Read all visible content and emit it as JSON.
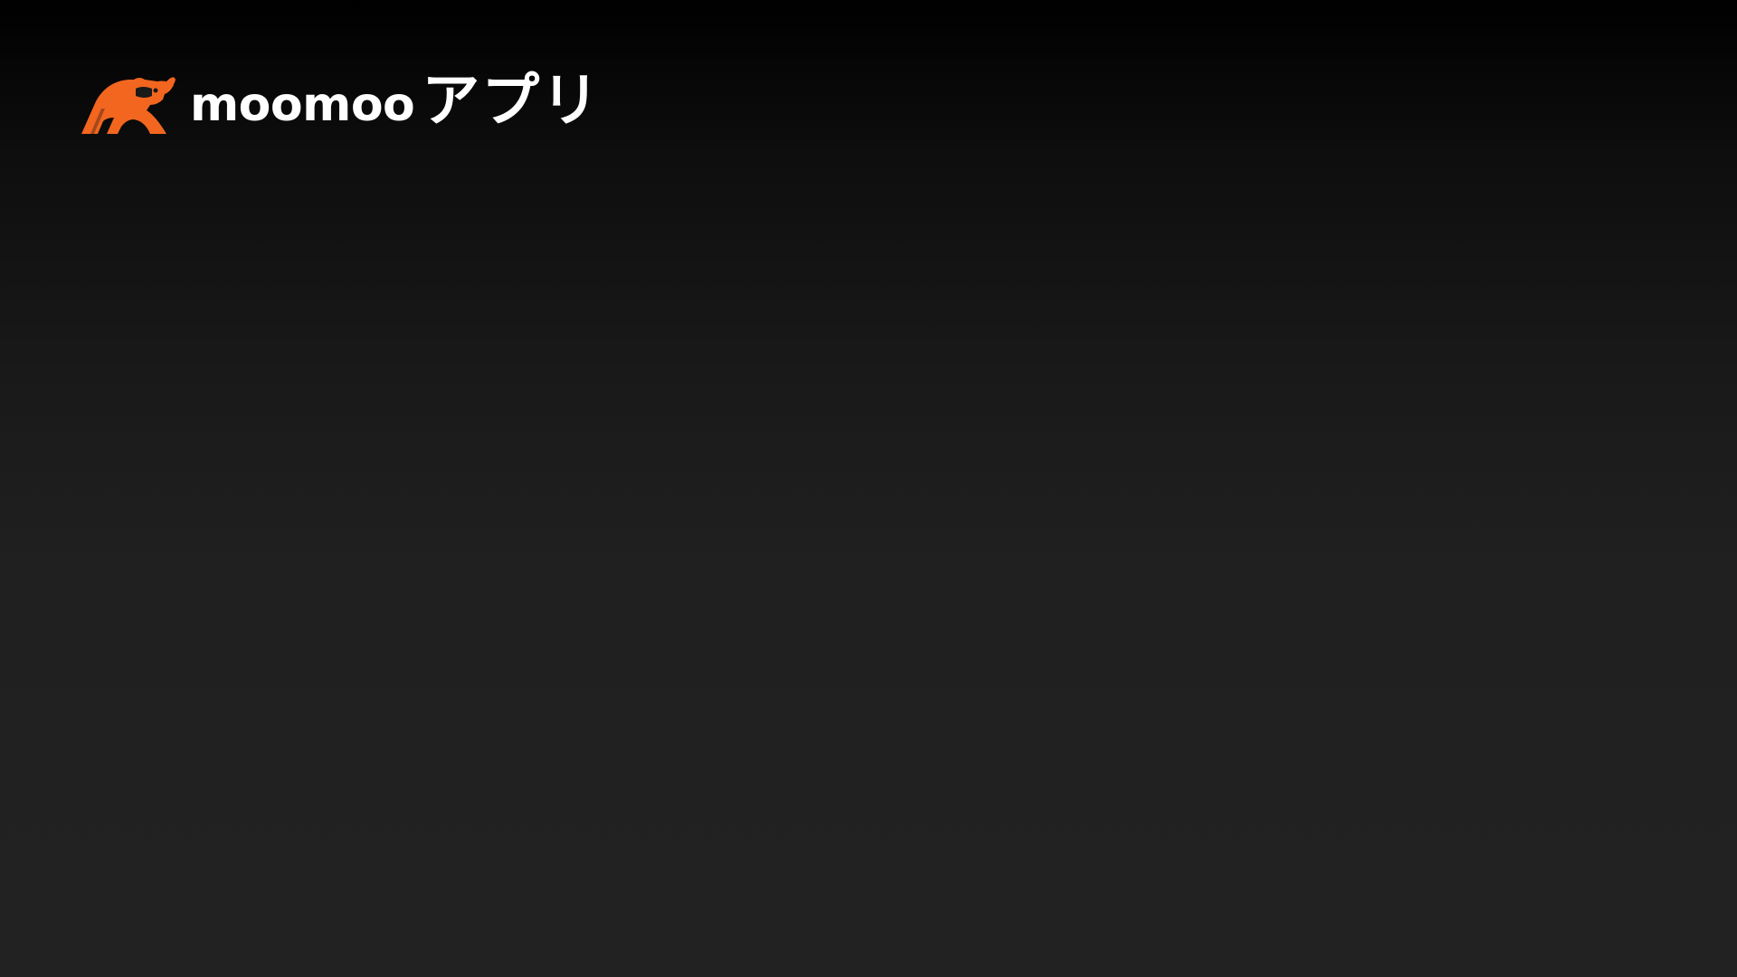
{
  "brand": {
    "name_latin": "moomoo",
    "name_jp": "アプリ",
    "logo_icon": "moomoo-bull-icon",
    "colors": {
      "logo": "#F2661F",
      "text": "#FFFFFF",
      "background_top": "#000000",
      "background_bottom": "#222222"
    }
  }
}
